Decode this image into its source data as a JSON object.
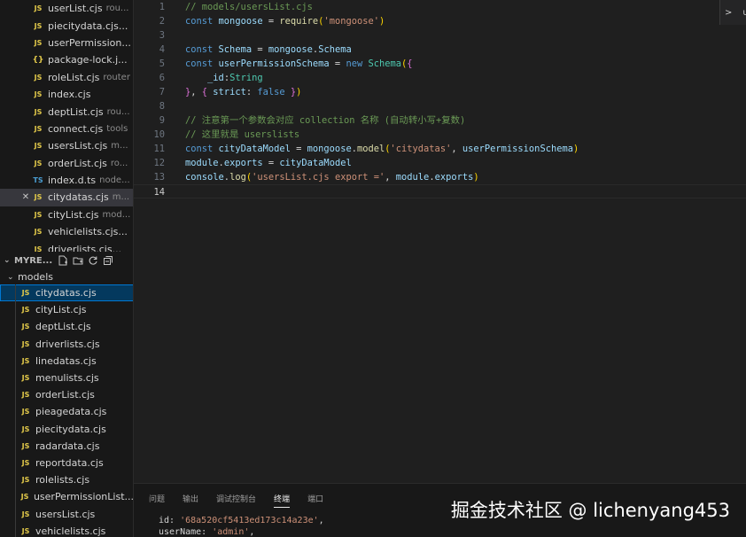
{
  "open_editors": [
    {
      "name": "userList.cjs",
      "desc": "rou...",
      "icon": "JS"
    },
    {
      "name": "piecitydata.cjs...",
      "desc": "",
      "icon": "JS"
    },
    {
      "name": "userPermission...",
      "desc": "",
      "icon": "JS"
    },
    {
      "name": "package-lock.j...",
      "desc": "",
      "icon": "{}"
    },
    {
      "name": "roleList.cjs",
      "desc": "router",
      "icon": "JS"
    },
    {
      "name": "index.cjs",
      "desc": "",
      "icon": "JS"
    },
    {
      "name": "deptList.cjs",
      "desc": "rou...",
      "icon": "JS"
    },
    {
      "name": "connect.cjs",
      "desc": "tools",
      "icon": "JS"
    },
    {
      "name": "usersList.cjs",
      "desc": "m...",
      "icon": "JS"
    },
    {
      "name": "orderList.cjs",
      "desc": "ro...",
      "icon": "JS"
    },
    {
      "name": "index.d.ts",
      "desc": "node...",
      "icon": "TS"
    },
    {
      "name": "citydatas.cjs",
      "desc": "m...",
      "icon": "JS",
      "active": true
    },
    {
      "name": "cityList.cjs",
      "desc": "mod...",
      "icon": "JS"
    },
    {
      "name": "vehiclelists.cjs...",
      "desc": "",
      "icon": "JS"
    },
    {
      "name": "driverlists.cjs...",
      "desc": "",
      "icon": "JS"
    }
  ],
  "explorer": {
    "title": "MYRE...",
    "chevron": "⌄",
    "folder": "models",
    "files": [
      "citydatas.cjs",
      "cityList.cjs",
      "deptList.cjs",
      "driverlists.cjs",
      "linedatas.cjs",
      "menulists.cjs",
      "orderList.cjs",
      "pieagedata.cjs",
      "piecitydata.cjs",
      "radardata.cjs",
      "reportdata.cjs",
      "rolelists.cjs",
      "userPermissionList...",
      "usersList.cjs",
      "vehiclelists.cjs"
    ],
    "selected_index": 0
  },
  "icons": {
    "js": "JS",
    "close": "✕",
    "folder_chevron": "⌄"
  },
  "editor": {
    "current_line": 14,
    "lines": [
      [
        [
          "c",
          "// models/usersList.cjs"
        ]
      ],
      [
        [
          "k",
          "const "
        ],
        [
          "v",
          "mongoose"
        ],
        [
          "o",
          " = "
        ],
        [
          "f",
          "require"
        ],
        [
          "b",
          "("
        ],
        [
          "s",
          "'mongoose'"
        ],
        [
          "b",
          ")"
        ]
      ],
      [],
      [
        [
          "k",
          "const "
        ],
        [
          "v",
          "Schema"
        ],
        [
          "o",
          " = "
        ],
        [
          "v",
          "mongoose"
        ],
        [
          "o",
          "."
        ],
        [
          "v",
          "Schema"
        ]
      ],
      [
        [
          "k",
          "const "
        ],
        [
          "v",
          "userPermissionSchema"
        ],
        [
          "o",
          " = "
        ],
        [
          "k",
          "new "
        ],
        [
          "t",
          "Schema"
        ],
        [
          "b",
          "("
        ],
        [
          "p",
          "{"
        ]
      ],
      [
        [
          "o",
          "    "
        ],
        [
          "v",
          "_id"
        ],
        [
          "o",
          ":"
        ],
        [
          "t",
          "String"
        ]
      ],
      [
        [
          "p",
          "}"
        ],
        [
          "o",
          ", "
        ],
        [
          "p",
          "{ "
        ],
        [
          "v",
          "strict"
        ],
        [
          "o",
          ": "
        ],
        [
          "k",
          "false"
        ],
        [
          "p",
          " }"
        ],
        [
          "b",
          ")"
        ]
      ],
      [],
      [
        [
          "c",
          "// 注意第一个参数会对应 collection 名称 (自动转小写+复数)"
        ]
      ],
      [
        [
          "c",
          "// 这里就是 userslists"
        ]
      ],
      [
        [
          "k",
          "const "
        ],
        [
          "v",
          "cityDataModel"
        ],
        [
          "o",
          " = "
        ],
        [
          "v",
          "mongoose"
        ],
        [
          "o",
          "."
        ],
        [
          "f",
          "model"
        ],
        [
          "b",
          "("
        ],
        [
          "s",
          "'citydatas'"
        ],
        [
          "o",
          ", "
        ],
        [
          "v",
          "userPermissionSchema"
        ],
        [
          "b",
          ")"
        ]
      ],
      [
        [
          "v",
          "module"
        ],
        [
          "o",
          "."
        ],
        [
          "v",
          "exports"
        ],
        [
          "o",
          " = "
        ],
        [
          "v",
          "cityDataModel"
        ]
      ],
      [
        [
          "v",
          "console"
        ],
        [
          "o",
          "."
        ],
        [
          "f",
          "log"
        ],
        [
          "b",
          "("
        ],
        [
          "s",
          "'usersList.cjs export ='"
        ],
        [
          "o",
          ", "
        ],
        [
          "v",
          "module"
        ],
        [
          "o",
          "."
        ],
        [
          "v",
          "exports"
        ],
        [
          "b",
          ")"
        ]
      ],
      []
    ]
  },
  "minimap_button": {
    "chevron": ">",
    "label": "u"
  },
  "panel": {
    "tabs": [
      "问题",
      "输出",
      "调试控制台",
      "终端",
      "端口"
    ],
    "active_tab": 3,
    "terminal_lines": [
      [
        [
          "o",
          "id: "
        ],
        [
          "s",
          "'68a520cf5413ed173c14a23e'"
        ],
        [
          "o",
          ","
        ]
      ],
      [
        [
          "o",
          "userName: "
        ],
        [
          "s",
          "'admin'"
        ],
        [
          "o",
          ","
        ]
      ]
    ]
  },
  "watermark": "掘金技术社区 @ lichenyang453"
}
